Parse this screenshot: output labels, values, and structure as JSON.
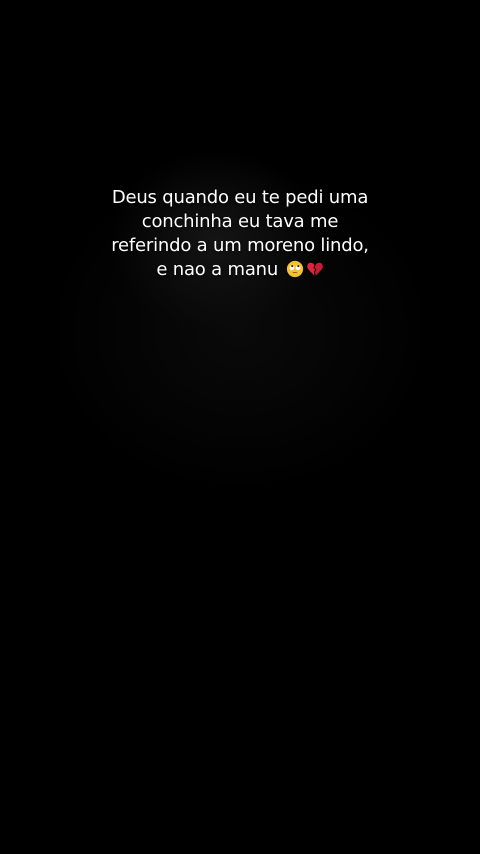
{
  "caption": {
    "lines": [
      "Deus quando eu te pedi uma",
      "conchinha eu tava me",
      "referindo a um moreno lindo,",
      "e nao a manu"
    ],
    "emojis": [
      "face-with-rolling-eyes-icon",
      "broken-heart-icon"
    ]
  },
  "colors": {
    "background": "#000000",
    "text": "#ffffff",
    "heart": "#e0253b",
    "emoji_face": "#f6c22e"
  }
}
